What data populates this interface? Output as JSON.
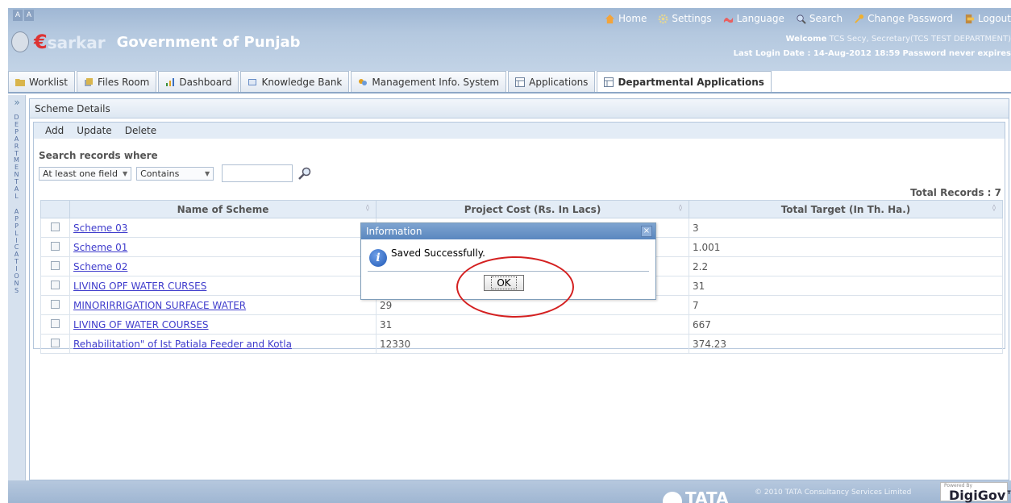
{
  "header": {
    "font_buttons": [
      "A",
      "A"
    ],
    "links": {
      "home": "Home",
      "settings": "Settings",
      "language": "Language",
      "search": "Search",
      "change_password": "Change Password",
      "logout": "Logout"
    },
    "brand_e": "€",
    "brand_sarkar": "sarkar",
    "brand_title": "Government of Punjab",
    "welcome_label": "Welcome",
    "welcome_user": "TCS Secy, Secretary(TCS TEST DEPARTMENT)",
    "last_login": "Last Login Date : 14-Aug-2012 18:59",
    "password_status": "Password never expires"
  },
  "tabs": [
    {
      "label": "Worklist",
      "icon": "folder-icon"
    },
    {
      "label": "Files Room",
      "icon": "files-icon"
    },
    {
      "label": "Dashboard",
      "icon": "chart-icon"
    },
    {
      "label": "Knowledge Bank",
      "icon": "book-icon"
    },
    {
      "label": "Management Info. System",
      "icon": "mis-icon"
    },
    {
      "label": "Applications",
      "icon": "grid-icon"
    },
    {
      "label": "Departmental Applications",
      "icon": "grid-icon",
      "active": true
    }
  ],
  "side_panel": {
    "expand": "»",
    "label": "DEPARTMENTAL APPLICATIONS"
  },
  "panel": {
    "title": "Scheme Details",
    "toolbar": {
      "add": "Add",
      "update": "Update",
      "delete": "Delete"
    },
    "search_title": "Search records where",
    "field_select": "At least one field",
    "operator_select": "Contains",
    "search_value": "",
    "total_records": "Total Records : 7"
  },
  "table": {
    "columns": [
      "Name of Scheme",
      "Project Cost (Rs. In Lacs)",
      "Total Target (In Th. Ha.)"
    ],
    "rows": [
      [
        "Scheme 03",
        "",
        "3"
      ],
      [
        "Scheme 01",
        "",
        "1.001"
      ],
      [
        "Scheme 02",
        "",
        "2.2"
      ],
      [
        "LIVING OPF WATER CURSES",
        "",
        "31"
      ],
      [
        "MINORIRRIGATION SURFACE WATER",
        "29",
        "7"
      ],
      [
        "LIVING OF WATER COURSES",
        "31",
        "667"
      ],
      [
        "Rehabilitation\" of Ist Patiala Feeder and Kotla",
        "12330",
        "374.23"
      ]
    ]
  },
  "dialog": {
    "title": "Information",
    "message": "Saved Successfully.",
    "ok": "OK",
    "close": "×"
  },
  "footer": {
    "tata": "TATA",
    "copyright": "© 2010 TATA Consultancy Services Limited",
    "powered_by": "Powered By",
    "digigov": "DigiGov™"
  },
  "colors": {
    "header": "#a9bfd9",
    "link": "#3f3ccc",
    "dialog_title": "#5a87bf",
    "highlight": "#d42020"
  }
}
